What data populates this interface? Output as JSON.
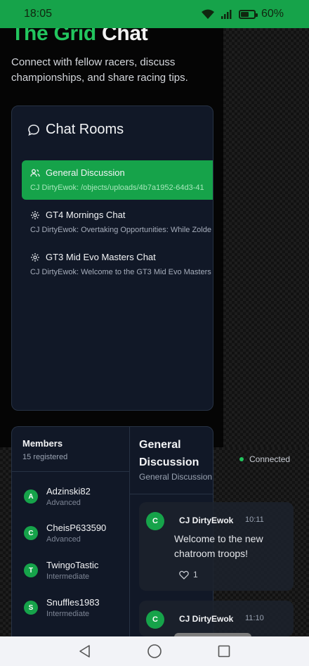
{
  "status_bar": {
    "time": "18:05",
    "battery": "60%",
    "battery_fraction": 0.6
  },
  "hero": {
    "title_green": "The Grid",
    "title_white": "Chat",
    "subtitle": "Connect with fellow racers, discuss championships, and share racing tips."
  },
  "rooms": {
    "title": "Chat Rooms",
    "items": [
      {
        "name": "General Discussion",
        "last": "CJ DirtyEwok: /objects/uploads/4b7a1952-64d3-41",
        "active": true,
        "icon": "users-icon"
      },
      {
        "name": "GT4 Mornings Chat",
        "last": "CJ DirtyEwok: Overtaking Opportunities: While Zolde",
        "active": false,
        "icon": "gear-icon"
      },
      {
        "name": "GT3 Mid Evo Masters Chat",
        "last": "CJ DirtyEwok: Welcome to the GT3 Mid Evo Masters",
        "active": false,
        "icon": "gear-icon"
      }
    ]
  },
  "members": {
    "title": "Members",
    "count": "15 registered",
    "items": [
      {
        "initial": "A",
        "name": "Adzinski82",
        "level": "Advanced"
      },
      {
        "initial": "C",
        "name": "CheisP633590",
        "level": "Advanced"
      },
      {
        "initial": "T",
        "name": "TwingoTastic",
        "level": "Intermediate"
      },
      {
        "initial": "S",
        "name": "Snuffles1983",
        "level": "Intermediate"
      }
    ]
  },
  "conversation": {
    "title": "General Discussion",
    "subtitle": "General Discussion",
    "connection": "Connected",
    "messages": [
      {
        "initial": "C",
        "author": "CJ DirtyEwok",
        "time": "10:11",
        "text": "Welcome to the new chatroom troops!",
        "likes": "1"
      },
      {
        "initial": "C",
        "author": "CJ DirtyEwok",
        "time": "11:10"
      }
    ]
  },
  "colors": {
    "accent": "#16a34a",
    "accent_text": "#22c55e",
    "panel": "#111827"
  }
}
